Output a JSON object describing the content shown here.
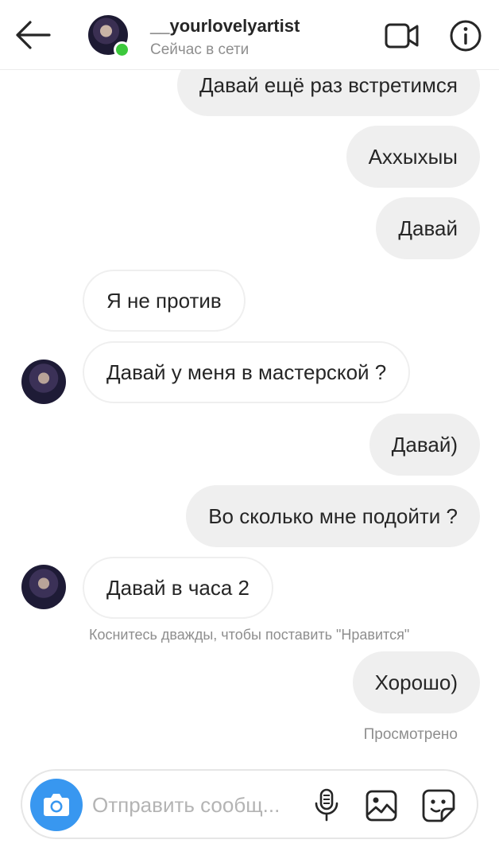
{
  "header": {
    "username": "__yourlovelyartist",
    "status": "Сейчас в сети",
    "back_icon": "arrow-left-icon",
    "video_icon": "video-camera-icon",
    "info_icon": "info-icon"
  },
  "messages": [
    {
      "direction": "out",
      "text": "Давай ещё раз встретимся"
    },
    {
      "direction": "out",
      "text": "Аххыхыы"
    },
    {
      "direction": "out",
      "text": "Давай"
    },
    {
      "direction": "in",
      "text": "Я не против"
    },
    {
      "direction": "in",
      "text": "Давай у меня в мастерской ?"
    },
    {
      "direction": "out",
      "text": "Давай)"
    },
    {
      "direction": "out",
      "text": "Во сколько мне подойти ?"
    },
    {
      "direction": "in",
      "text": "Давай в часа 2"
    },
    {
      "direction": "out",
      "text": "Хорошо)"
    }
  ],
  "hint": "Коснитесь дважды, чтобы поставить \"Нравится\"",
  "seen": "Просмотрено",
  "composer": {
    "placeholder": "Отправить сообщ...",
    "camera_icon": "camera-icon",
    "mic_icon": "microphone-icon",
    "gallery_icon": "gallery-icon",
    "sticker_icon": "sticker-icon"
  },
  "colors": {
    "accent": "#3897f0",
    "online": "#3cc83c",
    "outgoing_bubble": "#efefef",
    "secondary_text": "#8e8e8e"
  }
}
